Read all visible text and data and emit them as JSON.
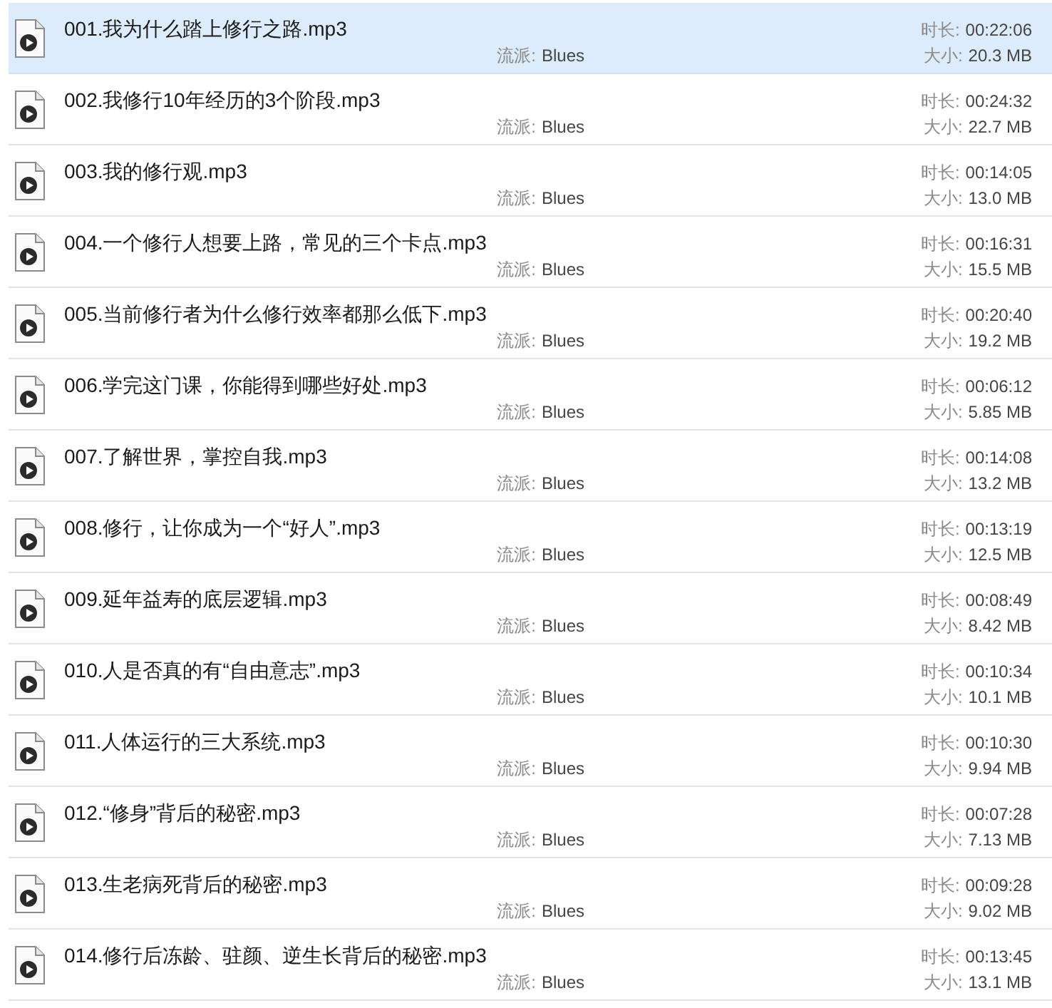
{
  "files": [
    {
      "name": "001.我为什么踏上修行之路.mp3",
      "genre_label": "流派:",
      "genre": "Blues",
      "duration_label": "时长:",
      "duration": "00:22:06",
      "size_label": "大小:",
      "size": "20.3 MB",
      "selected": true
    },
    {
      "name": "002.我修行10年经历的3个阶段.mp3",
      "genre_label": "流派:",
      "genre": "Blues",
      "duration_label": "时长:",
      "duration": "00:24:32",
      "size_label": "大小:",
      "size": "22.7 MB",
      "selected": false
    },
    {
      "name": "003.我的修行观.mp3",
      "genre_label": "流派:",
      "genre": "Blues",
      "duration_label": "时长:",
      "duration": "00:14:05",
      "size_label": "大小:",
      "size": "13.0 MB",
      "selected": false
    },
    {
      "name": "004.一个修行人想要上路，常见的三个卡点.mp3",
      "genre_label": "流派:",
      "genre": "Blues",
      "duration_label": "时长:",
      "duration": "00:16:31",
      "size_label": "大小:",
      "size": "15.5 MB",
      "selected": false
    },
    {
      "name": "005.当前修行者为什么修行效率都那么低下.mp3",
      "genre_label": "流派:",
      "genre": "Blues",
      "duration_label": "时长:",
      "duration": "00:20:40",
      "size_label": "大小:",
      "size": "19.2 MB",
      "selected": false
    },
    {
      "name": "006.学完这门课，你能得到哪些好处.mp3",
      "genre_label": "流派:",
      "genre": "Blues",
      "duration_label": "时长:",
      "duration": "00:06:12",
      "size_label": "大小:",
      "size": "5.85 MB",
      "selected": false
    },
    {
      "name": "007.了解世界，掌控自我.mp3",
      "genre_label": "流派:",
      "genre": "Blues",
      "duration_label": "时长:",
      "duration": "00:14:08",
      "size_label": "大小:",
      "size": "13.2 MB",
      "selected": false
    },
    {
      "name": "008.修行，让你成为一个“好人”.mp3",
      "genre_label": "流派:",
      "genre": "Blues",
      "duration_label": "时长:",
      "duration": "00:13:19",
      "size_label": "大小:",
      "size": "12.5 MB",
      "selected": false
    },
    {
      "name": "009.延年益寿的底层逻辑.mp3",
      "genre_label": "流派:",
      "genre": "Blues",
      "duration_label": "时长:",
      "duration": "00:08:49",
      "size_label": "大小:",
      "size": "8.42 MB",
      "selected": false
    },
    {
      "name": "010.人是否真的有“自由意志”.mp3",
      "genre_label": "流派:",
      "genre": "Blues",
      "duration_label": "时长:",
      "duration": "00:10:34",
      "size_label": "大小:",
      "size": "10.1 MB",
      "selected": false
    },
    {
      "name": "011.人体运行的三大系统.mp3",
      "genre_label": "流派:",
      "genre": "Blues",
      "duration_label": "时长:",
      "duration": "00:10:30",
      "size_label": "大小:",
      "size": "9.94 MB",
      "selected": false
    },
    {
      "name": "012.“修身”背后的秘密.mp3",
      "genre_label": "流派:",
      "genre": "Blues",
      "duration_label": "时长:",
      "duration": "00:07:28",
      "size_label": "大小:",
      "size": "7.13 MB",
      "selected": false
    },
    {
      "name": "013.生老病死背后的秘密.mp3",
      "genre_label": "流派:",
      "genre": "Blues",
      "duration_label": "时长:",
      "duration": "00:09:28",
      "size_label": "大小:",
      "size": "9.02 MB",
      "selected": false
    },
    {
      "name": "014.修行后冻龄、驻颜、逆生长背后的秘密.mp3",
      "genre_label": "流派:",
      "genre": "Blues",
      "duration_label": "时长:",
      "duration": "00:13:45",
      "size_label": "大小:",
      "size": "13.1 MB",
      "selected": false
    }
  ]
}
